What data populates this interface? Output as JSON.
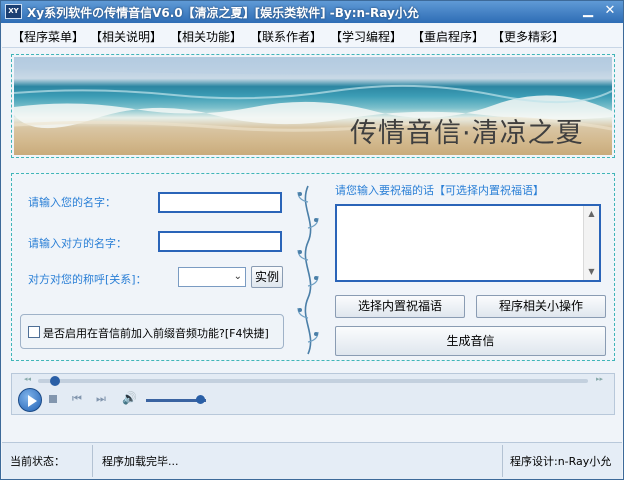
{
  "window": {
    "icon_text": "XY",
    "title": "Xy系列软件の传情音信V6.0【清凉之夏】[娱乐类软件]  -By:n-Ray小允",
    "minimize_glyph": "▁",
    "close_glyph": "✕"
  },
  "menu": [
    {
      "label": "【程序菜单】"
    },
    {
      "label": "【相关说明】"
    },
    {
      "label": "【相关功能】"
    },
    {
      "label": "【联系作者】"
    },
    {
      "label": "【学习编程】"
    },
    {
      "label": "【重启程序】"
    },
    {
      "label": "【更多精彩】"
    }
  ],
  "banner": {
    "text": "传情音信·清凉之夏"
  },
  "form": {
    "your_name_label": "请输入您的名字：",
    "your_name_value": "",
    "other_name_label": "请输入对方的名字：",
    "other_name_value": "",
    "relation_label": "对方对您的称呼[关系]：",
    "relation_value": "",
    "example_button": "实例",
    "audio_option_label": "是否启用在音信前加入前缀音频功能?[F4快捷]",
    "audio_option_checked": false,
    "bless_label": "请您输入要祝福的话【可选择内置祝福语】",
    "bless_value": "",
    "choose_bless_button": "选择内置祝福语",
    "program_ops_button": "程序相关小操作",
    "generate_button": "生成音信"
  },
  "player": {
    "seek_progress": 0.03,
    "volume_level": 0.9,
    "seek_back_glyph": "◂◂",
    "seek_fwd_glyph": "▸▸",
    "prev_glyph": "⏮",
    "next_glyph": "⏭",
    "volume_glyph": "🔊"
  },
  "status": {
    "state_label": "当前状态：",
    "state_value": "程序加载完毕...",
    "designer": "程序设计:n-Ray小允"
  },
  "colors": {
    "title_bar": "#2e6db5",
    "label_blue": "#2a7fd6",
    "input_border": "#2a64b8",
    "frame_dash": "#3fb5b8"
  }
}
